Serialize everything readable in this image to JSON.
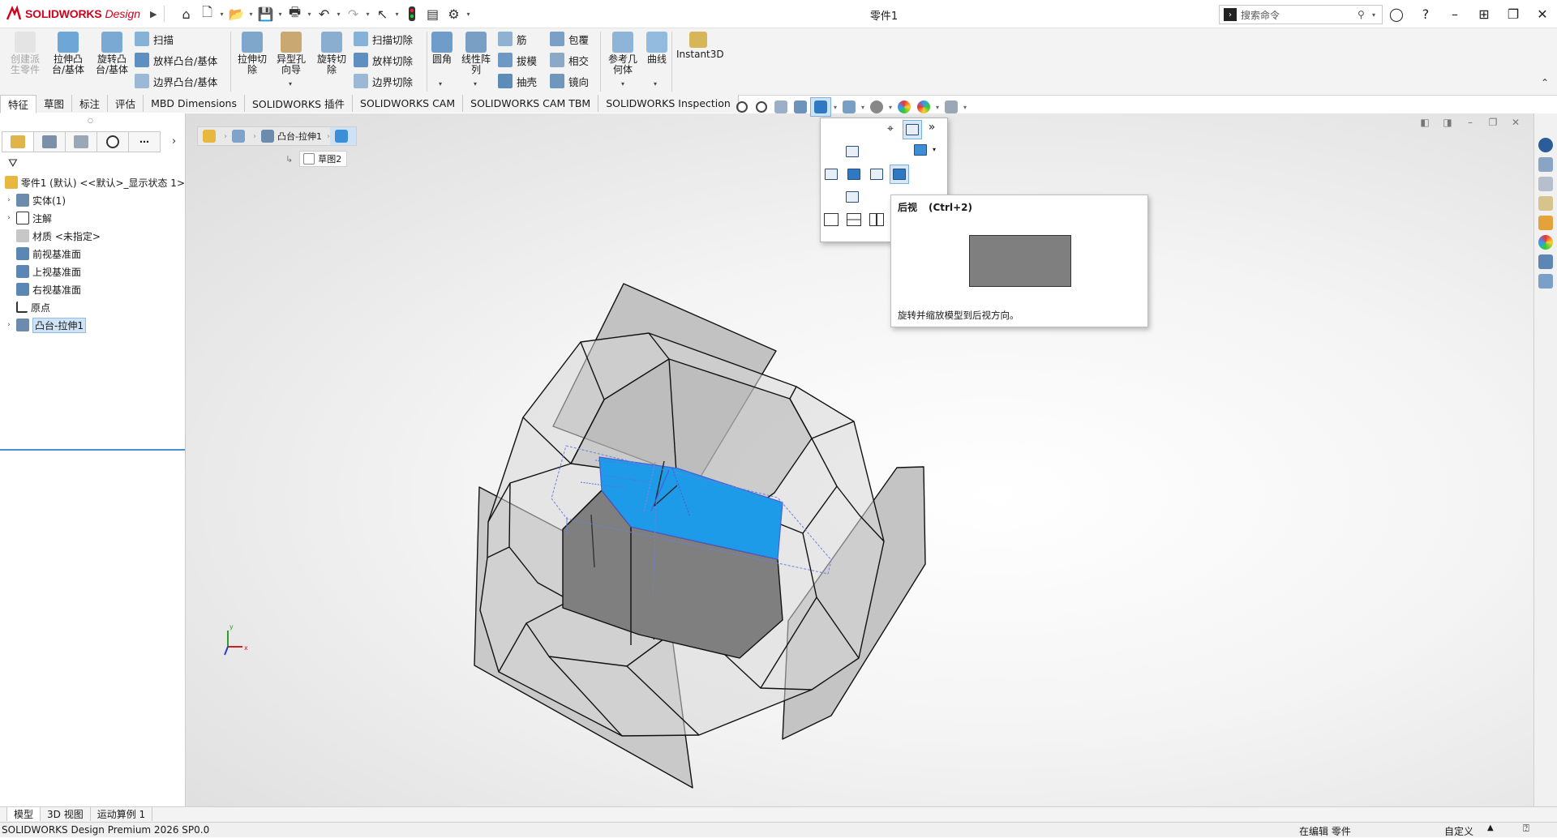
{
  "app": {
    "brand": "SOLIDWORKS",
    "brand_suffix": "Design",
    "document_title": "零件1",
    "search_placeholder": "搜索命令"
  },
  "ribbon": {
    "big_buttons": [
      {
        "label": "创建派\n生零件",
        "enabled": false
      },
      {
        "label": "拉伸凸\n台/基体",
        "enabled": true
      },
      {
        "label": "旋转凸\n台/基体",
        "enabled": true
      },
      {
        "label": "拉伸切\n除",
        "enabled": true
      },
      {
        "label": "异型孔\n向导",
        "enabled": true
      },
      {
        "label": "旋转切\n除",
        "enabled": true
      },
      {
        "label": "圆角",
        "enabled": true
      },
      {
        "label": "线性阵\n列",
        "enabled": true
      },
      {
        "label": "参考几\n何体",
        "enabled": true
      },
      {
        "label": "曲线",
        "enabled": true
      },
      {
        "label": "Instant3D",
        "enabled": true
      }
    ],
    "small_buttons": {
      "sweep": "扫描",
      "loft": "放样凸台/基体",
      "boundary": "边界凸台/基体",
      "swept_cut": "扫描切除",
      "lofted_cut": "放样切除",
      "boundary_cut": "边界切除",
      "rib": "筋",
      "draft": "拔模",
      "shell": "抽壳",
      "wrap": "包覆",
      "intersect": "相交",
      "mirror": "镜向"
    }
  },
  "tabs": [
    "特征",
    "草图",
    "标注",
    "评估",
    "MBD Dimensions",
    "SOLIDWORKS 插件",
    "SOLIDWORKS CAM",
    "SOLIDWORKS CAM TBM",
    "SOLIDWORKS Inspection"
  ],
  "active_tab": "特征",
  "tree": {
    "root": "零件1 (默认) <<默认>_显示状态 1>",
    "items": [
      {
        "label": "实体(1)",
        "expandable": true
      },
      {
        "label": "注解",
        "expandable": true
      },
      {
        "label": "材质 <未指定>",
        "expandable": false
      },
      {
        "label": "前视基准面",
        "expandable": false
      },
      {
        "label": "上视基准面",
        "expandable": false
      },
      {
        "label": "右视基准面",
        "expandable": false
      },
      {
        "label": "原点",
        "expandable": false
      },
      {
        "label": "凸台-拉伸1",
        "expandable": true,
        "selected": true
      }
    ]
  },
  "breadcrumb": {
    "feature": "凸台-拉伸1",
    "sketch": "草图2"
  },
  "tooltip": {
    "title": "后视",
    "shortcut": "(Ctrl+2)",
    "description": "旋转并缩放模型到后视方向。"
  },
  "triad": {
    "x": "x",
    "y": "y"
  },
  "bottom_tabs": [
    "模型",
    "3D 视图",
    "运动算例 1"
  ],
  "active_bottom_tab": "模型",
  "status": {
    "version": "SOLIDWORKS Design Premium 2026 SP0.0",
    "editing": "在编辑 零件",
    "units": "自定义"
  },
  "colors": {
    "brand_red": "#d0021b",
    "selection_blue": "#1e9be8",
    "model_gray": "#7f7f7f",
    "accent_blue": "#4a90d9"
  }
}
